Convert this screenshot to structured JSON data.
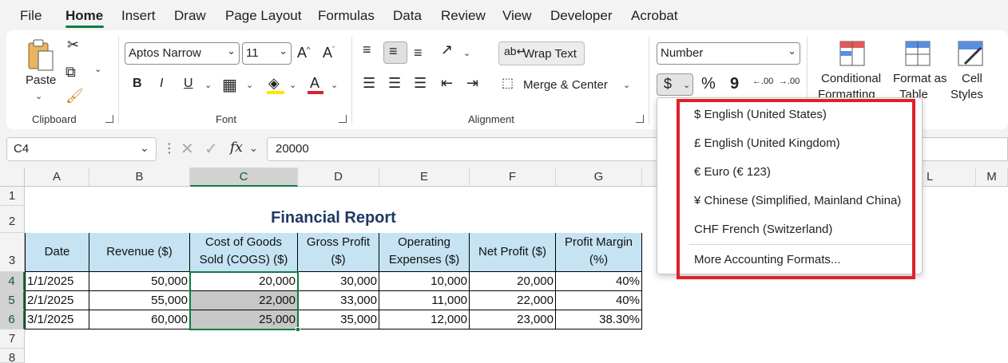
{
  "menu": {
    "tabs": [
      "File",
      "Home",
      "Insert",
      "Draw",
      "Page Layout",
      "Formulas",
      "Data",
      "Review",
      "View",
      "Developer",
      "Acrobat"
    ],
    "active": "Home"
  },
  "ribbon": {
    "clipboard": {
      "label": "Clipboard",
      "paste": "Paste"
    },
    "font": {
      "label": "Font",
      "name": "Aptos Narrow",
      "size": "11",
      "bold": "B",
      "italic": "I",
      "underline": "U"
    },
    "alignment": {
      "label": "Alignment",
      "wrap_text": "Wrap Text",
      "merge_center": "Merge & Center"
    },
    "number": {
      "format": "Number",
      "currency": "$",
      "percent": "%",
      "comma": "9",
      "inc_decimal": ".00",
      "dec_decimal": ".00"
    },
    "styles": {
      "conditional": [
        "Conditional",
        "Formatting"
      ],
      "format_table": [
        "Format as",
        "Table"
      ],
      "cell_styles": [
        "Cell",
        "Styles"
      ]
    }
  },
  "formula_bar": {
    "name_box": "C4",
    "fx": "fx",
    "value": "20000"
  },
  "columns": [
    "A",
    "B",
    "C",
    "D",
    "E",
    "F",
    "G",
    "L",
    "M"
  ],
  "rows": [
    "1",
    "2",
    "3",
    "4",
    "5",
    "6",
    "7",
    "8"
  ],
  "sheet": {
    "title": "Financial Report",
    "headers": [
      "Date",
      "Revenue ($)",
      "Cost of Goods Sold (COGS) ($)",
      "Gross Profit ($)",
      "Operating Expenses ($)",
      "Net Profit ($)",
      "Profit Margin (%)"
    ],
    "data": [
      [
        "1/1/2025",
        "50,000",
        "20,000",
        "30,000",
        "10,000",
        "20,000",
        "40%"
      ],
      [
        "2/1/2025",
        "55,000",
        "22,000",
        "33,000",
        "11,000",
        "22,000",
        "40%"
      ],
      [
        "3/1/2025",
        "60,000",
        "25,000",
        "35,000",
        "12,000",
        "23,000",
        "38.30%"
      ]
    ]
  },
  "accounting_menu": {
    "items": [
      "$ English (United States)",
      "£ English (United Kingdom)",
      "€ Euro (€ 123)",
      "¥ Chinese (Simplified, Mainland China)",
      "CHF French (Switzerland)"
    ],
    "more": "More Accounting Formats..."
  },
  "colors": {
    "accent": "#107c41",
    "header_fill": "#c5e3f2",
    "highlight": "#e0202a"
  }
}
